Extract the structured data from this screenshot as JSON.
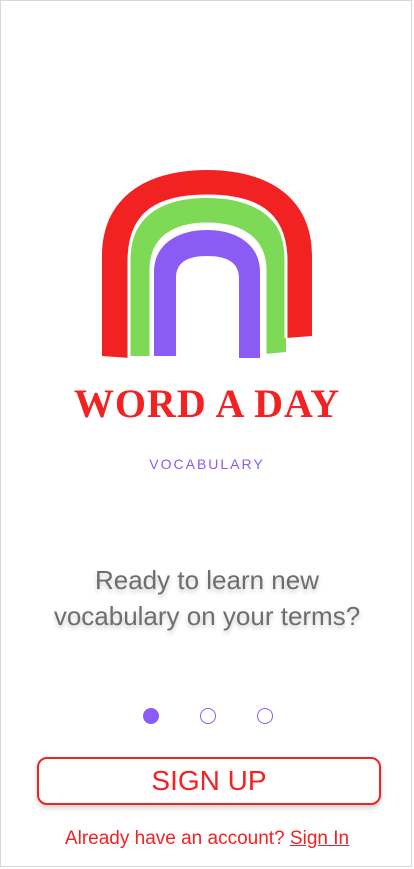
{
  "brand": {
    "title": "WORD A DAY",
    "subtitle": "VOCABULARY",
    "logo_icon": "rainbow-icon",
    "colors": {
      "red": "#f22222",
      "green": "#7ed957",
      "purple": "#8a5cf5",
      "gray_text": "#6e6e6e"
    }
  },
  "onboarding": {
    "tagline_line1": "Ready to learn new",
    "tagline_line2": "vocabulary on your terms?",
    "page_indicator": {
      "total": 3,
      "current": 1
    }
  },
  "actions": {
    "signup_label": "SIGN UP",
    "signin_prompt": "Already have an account? ",
    "signin_label": "Sign In"
  }
}
